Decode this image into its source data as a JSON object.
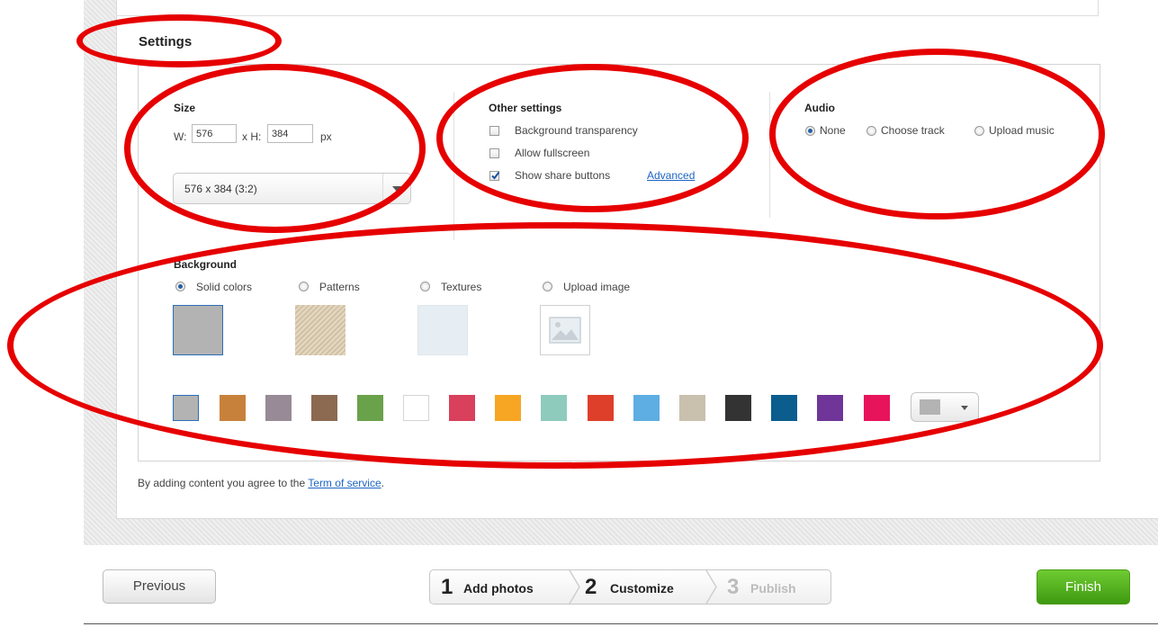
{
  "settings": {
    "title": "Settings",
    "size": {
      "label": "Size",
      "w_label": "W:",
      "w_value": "576",
      "h_label": "x H:",
      "h_value": "384",
      "unit": "px",
      "preset": "576 x 384 (3:2)"
    },
    "other": {
      "label": "Other settings",
      "options": [
        {
          "label": "Background transparency",
          "checked": false
        },
        {
          "label": "Allow fullscreen",
          "checked": false
        },
        {
          "label": "Show share buttons",
          "checked": true
        }
      ],
      "advanced_link": "Advanced"
    },
    "audio": {
      "label": "Audio",
      "options": [
        "None",
        "Choose track",
        "Upload music"
      ],
      "selected": "None"
    },
    "background": {
      "label": "Background",
      "options": [
        "Solid colors",
        "Patterns",
        "Textures",
        "Upload image"
      ],
      "selected": "Solid colors",
      "swatches": [
        "#b3b3b3",
        "#c8813b",
        "#988a96",
        "#8c6a52",
        "#6aa14b",
        "#ffffff",
        "#d8405c",
        "#f6a623",
        "#8ecbbd",
        "#de3f2a",
        "#5eaee3",
        "#c9c0ad",
        "#333333",
        "#0b5d8e",
        "#6f3598",
        "#e8145b"
      ],
      "custom_color": "#b3b3b3"
    }
  },
  "terms": {
    "text": "By adding content you agree to the ",
    "link": "Term of service",
    "end": "."
  },
  "footer": {
    "previous": "Previous",
    "steps": [
      {
        "num": "1",
        "label": "Add photos",
        "state": "done"
      },
      {
        "num": "2",
        "label": "Customize",
        "state": "current"
      },
      {
        "num": "3",
        "label": "Publish",
        "state": "pending"
      }
    ],
    "finish": "Finish"
  },
  "colors": {
    "annotation_ring": "#e60000",
    "finish_green": "#4fae1f",
    "link": "#1c64c4"
  }
}
